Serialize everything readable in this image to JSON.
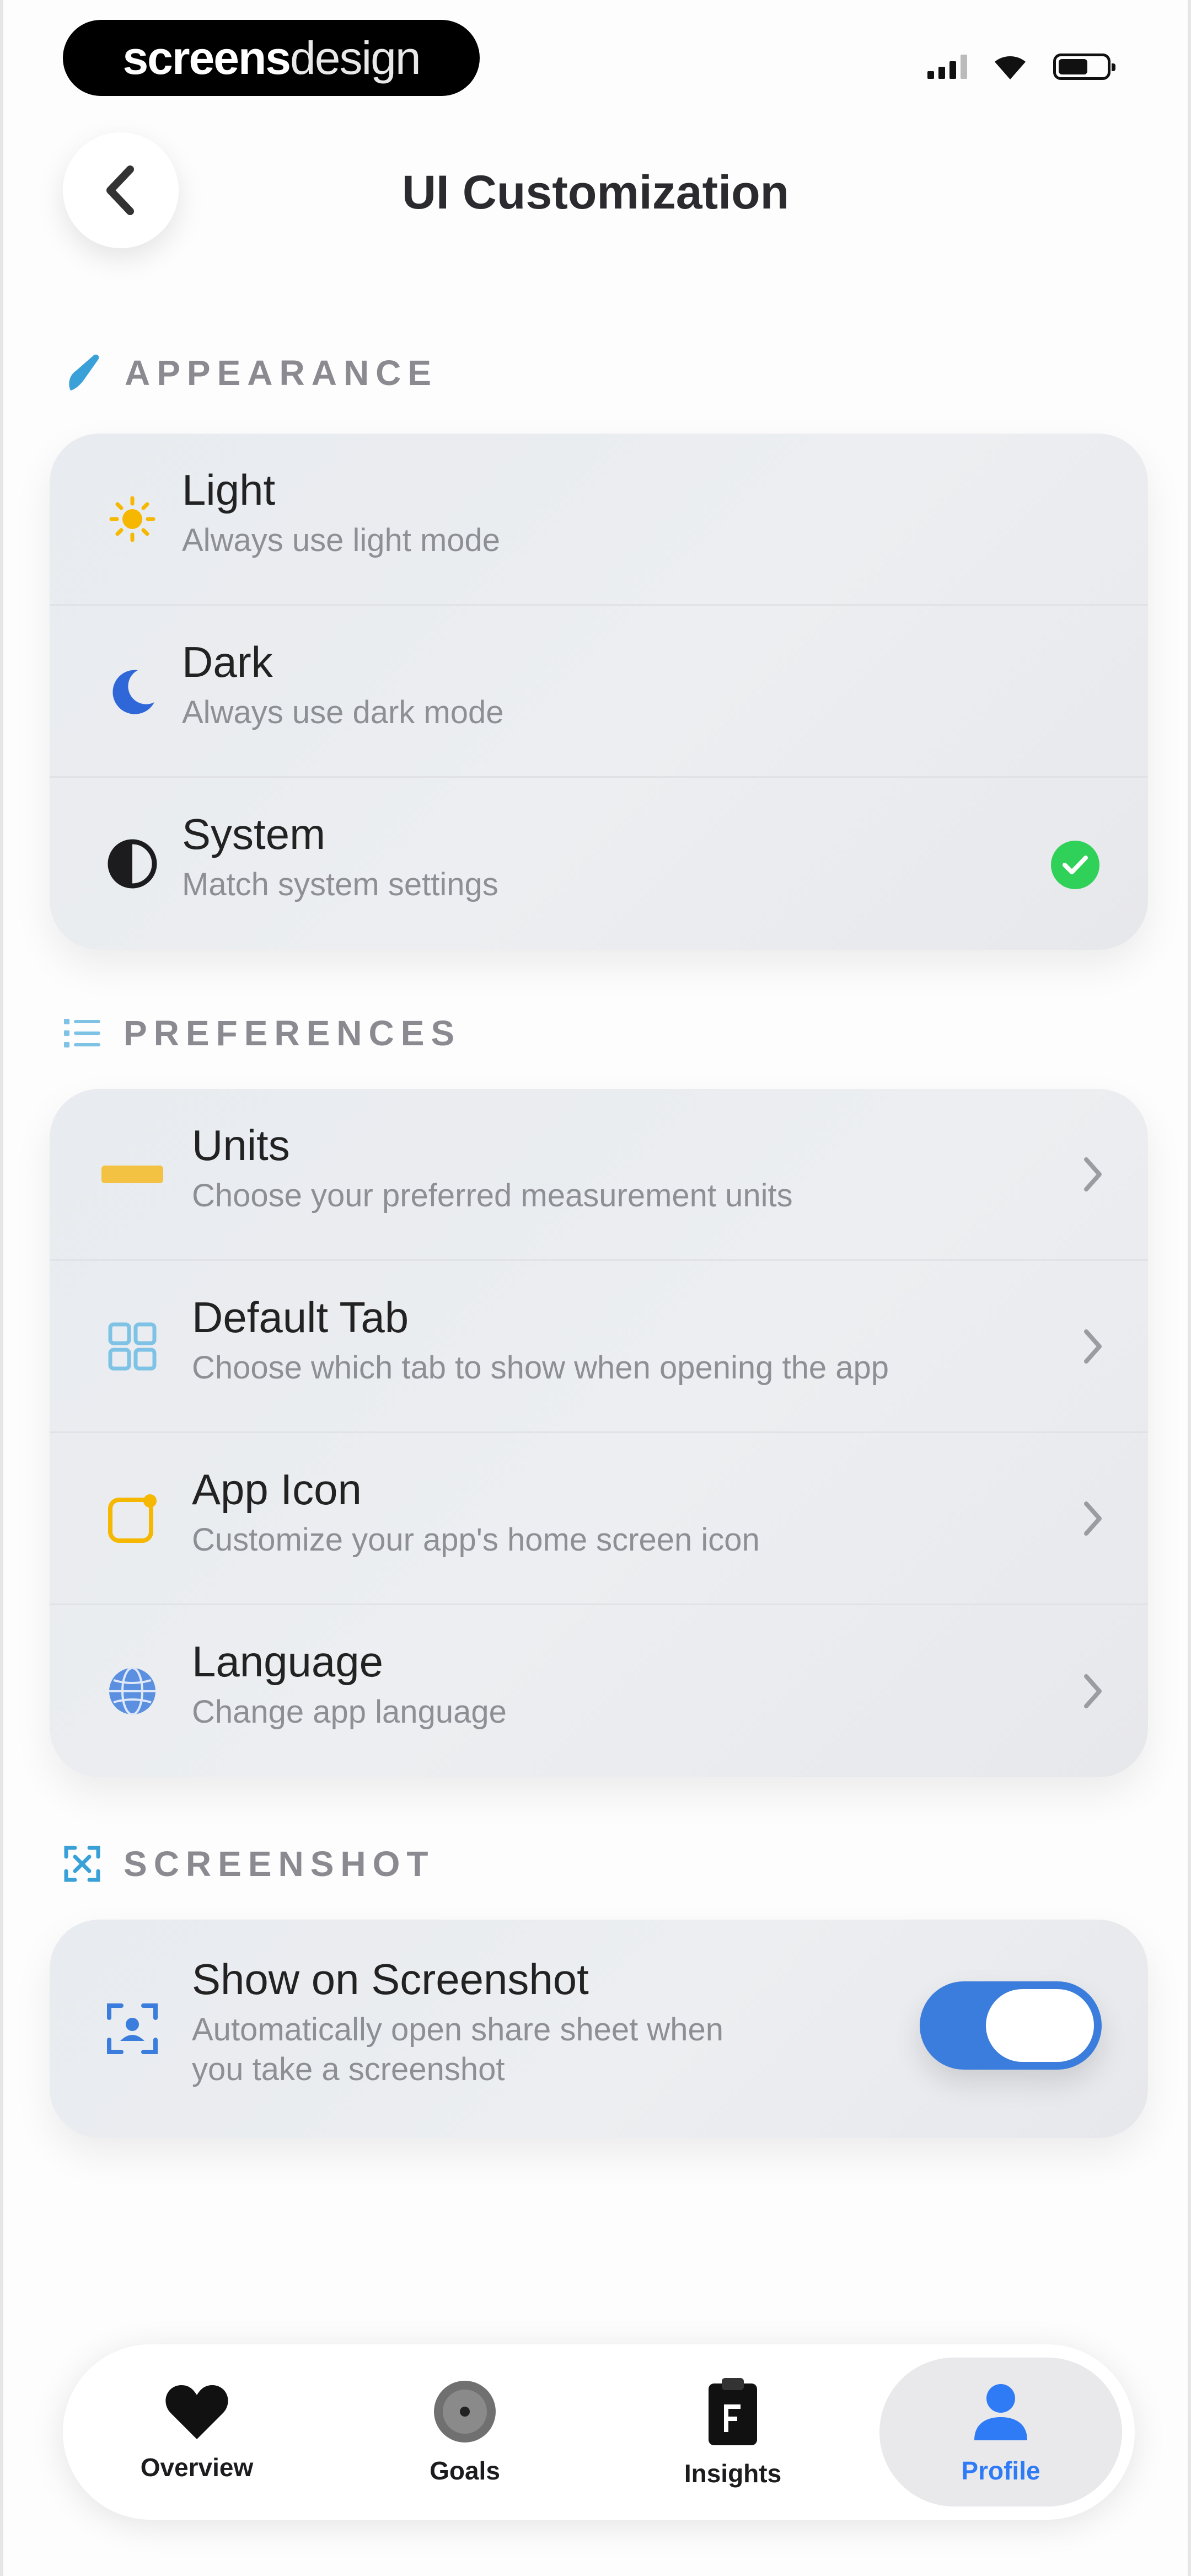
{
  "status_bar": {
    "brand_bold": "screens",
    "brand_light": "design"
  },
  "header": {
    "title": "UI Customization"
  },
  "appearance": {
    "header": "APPEARANCE",
    "options": [
      {
        "title": "Light",
        "subtitle": "Always use light mode",
        "icon": "sun-icon"
      },
      {
        "title": "Dark",
        "subtitle": "Always use dark mode",
        "icon": "moon-icon"
      },
      {
        "title": "System",
        "subtitle": "Match system settings",
        "icon": "half-circle-icon",
        "selected": true
      }
    ]
  },
  "preferences": {
    "header": "PREFERENCES",
    "items": [
      {
        "title": "Units",
        "subtitle": "Choose your preferred measurement units",
        "icon": "ruler-icon"
      },
      {
        "title": "Default Tab",
        "subtitle": "Choose which tab to show when opening the app",
        "icon": "grid-icon"
      },
      {
        "title": "App Icon",
        "subtitle": "Customize your app's home screen icon",
        "icon": "app-icon-icon"
      },
      {
        "title": "Language",
        "subtitle": "Change app language",
        "icon": "globe-icon"
      }
    ]
  },
  "screenshot": {
    "header": "SCREENSHOT",
    "item": {
      "title": "Show on Screenshot",
      "subtitle_line1": "Automatically open share sheet when",
      "subtitle_line2": "you take a screenshot",
      "icon": "screenshot-icon",
      "enabled": true
    }
  },
  "tabbar": {
    "tabs": [
      {
        "label": "Overview",
        "icon": "heart-icon"
      },
      {
        "label": "Goals",
        "icon": "target-icon"
      },
      {
        "label": "Insights",
        "icon": "clipboard-icon"
      },
      {
        "label": "Profile",
        "icon": "person-icon",
        "active": true
      }
    ]
  },
  "colors": {
    "accent_blue": "#2f7bf6",
    "check_green": "#30d158",
    "toggle_blue": "#3b7ddd",
    "sun_yellow": "#f5b700",
    "section_icon_blue": "#3aa0d8"
  }
}
